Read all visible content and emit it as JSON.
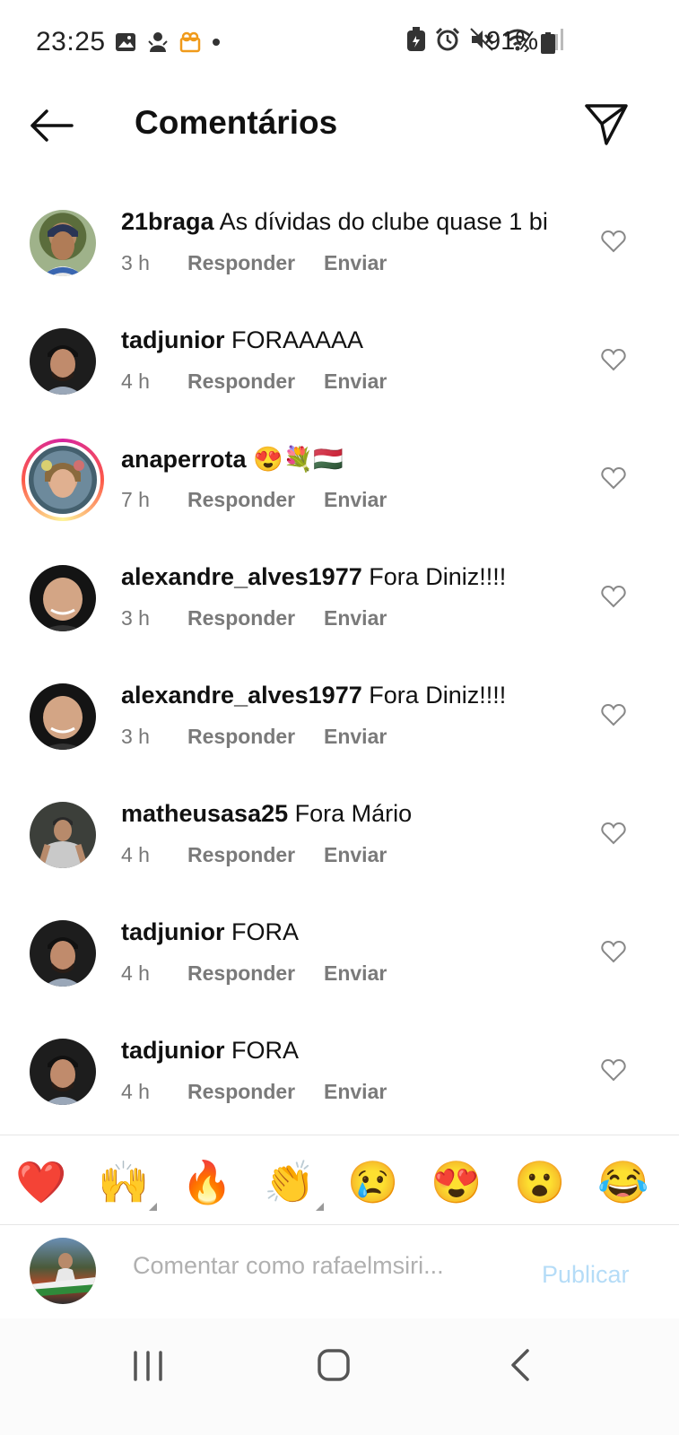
{
  "status_bar": {
    "time": "23:25",
    "battery": "91%",
    "left_icons": [
      "gallery-icon",
      "app-icon",
      "app-icon-orange",
      "dot-icon"
    ],
    "right_icons": [
      "battery-saver-icon",
      "alarm-icon",
      "mute-icon",
      "wifi-icon",
      "signal-icon"
    ]
  },
  "header": {
    "title": "Comentários"
  },
  "comments": [
    {
      "username": "21braga",
      "text": "As dívidas do clube quase 1 bi",
      "time": "3 h",
      "reply": "Responder",
      "send": "Enviar"
    },
    {
      "username": "tadjunior",
      "text": "FORAAAAA",
      "time": "4 h",
      "reply": "Responder",
      "send": "Enviar"
    },
    {
      "username": "anaperrota",
      "text": "😍💐🇭🇺",
      "time": "7 h",
      "reply": "Responder",
      "send": "Enviar"
    },
    {
      "username": "alexandre_alves1977",
      "text": "Fora Diniz!!!!",
      "time": "3 h",
      "reply": "Responder",
      "send": "Enviar"
    },
    {
      "username": "alexandre_alves1977",
      "text": "Fora Diniz!!!!",
      "time": "3 h",
      "reply": "Responder",
      "send": "Enviar"
    },
    {
      "username": "matheusasa25",
      "text": "Fora Mário",
      "time": "4 h",
      "reply": "Responder",
      "send": "Enviar"
    },
    {
      "username": "tadjunior",
      "text": "FORA",
      "time": "4 h",
      "reply": "Responder",
      "send": "Enviar"
    },
    {
      "username": "tadjunior",
      "text": "FORA",
      "time": "4 h",
      "reply": "Responder",
      "send": "Enviar"
    }
  ],
  "reactions": [
    "❤️",
    "🙌",
    "🔥",
    "👏",
    "😢",
    "😍",
    "😮",
    "😂"
  ],
  "composer": {
    "placeholder": "Comentar como rafaelmsiri...",
    "publish_label": "Publicar"
  },
  "colors": {
    "publish_disabled": "#b5dcf7",
    "meta_text": "#777777"
  }
}
